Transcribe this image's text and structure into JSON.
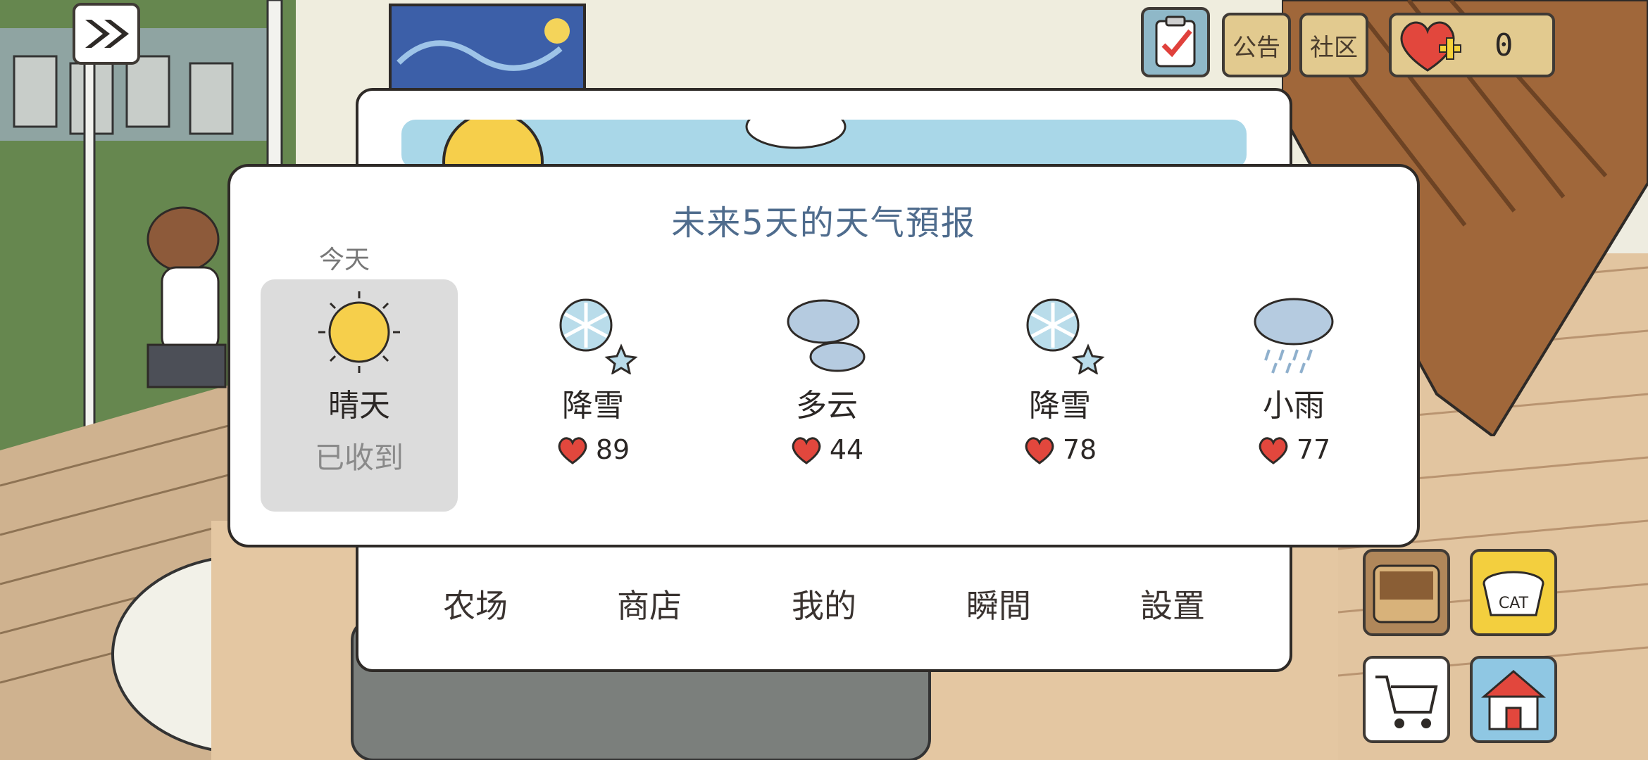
{
  "hud": {
    "announcement": "公告",
    "community": "社区",
    "hearts": "0"
  },
  "dialog": {
    "title": "未来5天的天气預报",
    "today_label": "今天",
    "days": [
      {
        "name": "晴天",
        "status": "已收到",
        "icon": "sun-icon"
      },
      {
        "name": "降雪",
        "reward": "89",
        "icon": "snowflake-icon"
      },
      {
        "name": "多云",
        "reward": "44",
        "icon": "cloud-icon"
      },
      {
        "name": "降雪",
        "reward": "78",
        "icon": "snowflake-icon"
      },
      {
        "name": "小雨",
        "reward": "77",
        "icon": "rain-cloud-icon"
      }
    ]
  },
  "menu": {
    "items": [
      "农场",
      "商店",
      "我的",
      "瞬間",
      "設置"
    ]
  },
  "colors": {
    "title_blue": "#4f6c8d",
    "heart_red": "#e2473d",
    "sun_yellow": "#f6cf4b",
    "snow_blue": "#b9dcea",
    "cloud_blue": "#b5cbe0",
    "today_card": "#dcdcdc"
  }
}
